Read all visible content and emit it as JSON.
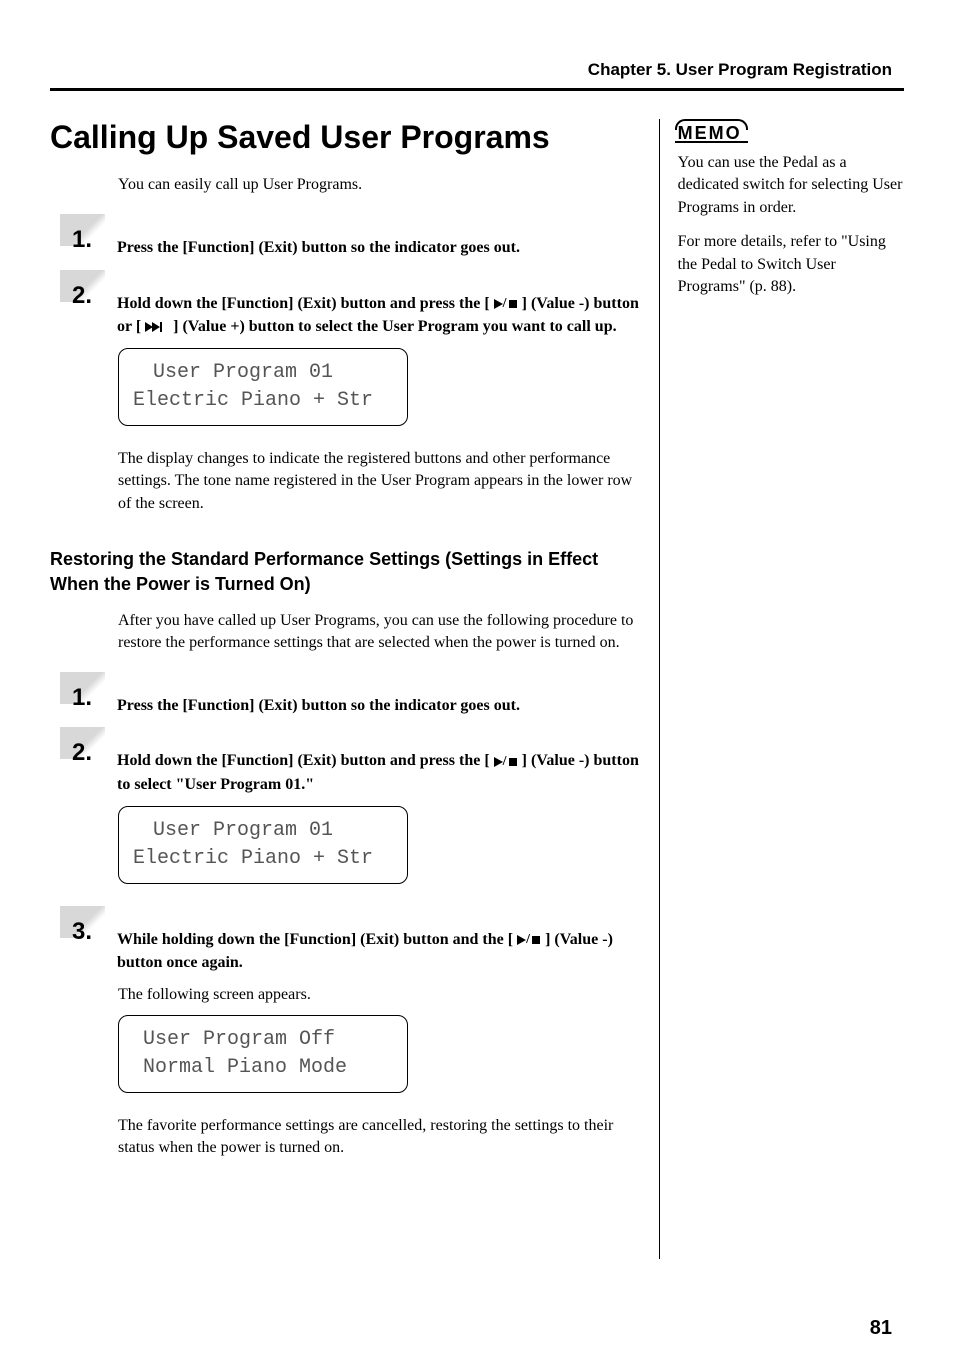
{
  "chapter_header": "Chapter 5. User Program Registration",
  "title": "Calling Up Saved User Programs",
  "intro": "You can easily call up User Programs.",
  "callup": {
    "step1": "Press the [Function] (Exit) button so the indicator goes out.",
    "step2_a": "Hold down the [Function] (Exit) button and press the [ ",
    "step2_b": " ] (Value -) button or [ ",
    "step2_c": " ] (Value +) button to select the User Program you want to call up.",
    "lcd1_l1": "User Program 01",
    "lcd1_l2": "Electric Piano + Str",
    "after1": "The display changes to indicate the registered buttons and other performance settings. The tone name registered in the User Program appears in the lower row of the screen."
  },
  "subhead": "Restoring the Standard Performance Settings (Settings in Effect When the Power is Turned On)",
  "restore": {
    "intro": "After you have called up User Programs, you can use the following procedure to restore the performance settings that are selected when the power is turned on.",
    "step1": "Press the [Function] (Exit) button so the indicator goes out.",
    "step2_a": "Hold down the [Function] (Exit) button and press the [ ",
    "step2_b": " ] (Value -) button to select \"User Program 01.\"",
    "lcd2_l1": "User Program 01",
    "lcd2_l2": "Electric Piano + Str",
    "step3_a": "While holding down the [Function] (Exit) button and the [ ",
    "step3_b": " ] (Value -) button once again.",
    "after3a": "The following screen appears.",
    "lcd3_l1": "User Program Off",
    "lcd3_l2": "Normal Piano Mode",
    "after3b": "The favorite performance settings are cancelled, restoring the settings to their status when the power is turned on."
  },
  "memo_label": "MEMO",
  "memo_text1": "You can use the Pedal as a dedicated switch for selecting User Programs in order.",
  "memo_text2": "For more details, refer to \"Using the Pedal to Switch User Programs\" (p. 88).",
  "page_number": "81",
  "nums": {
    "one": "1.",
    "two": "2.",
    "three": "3."
  }
}
